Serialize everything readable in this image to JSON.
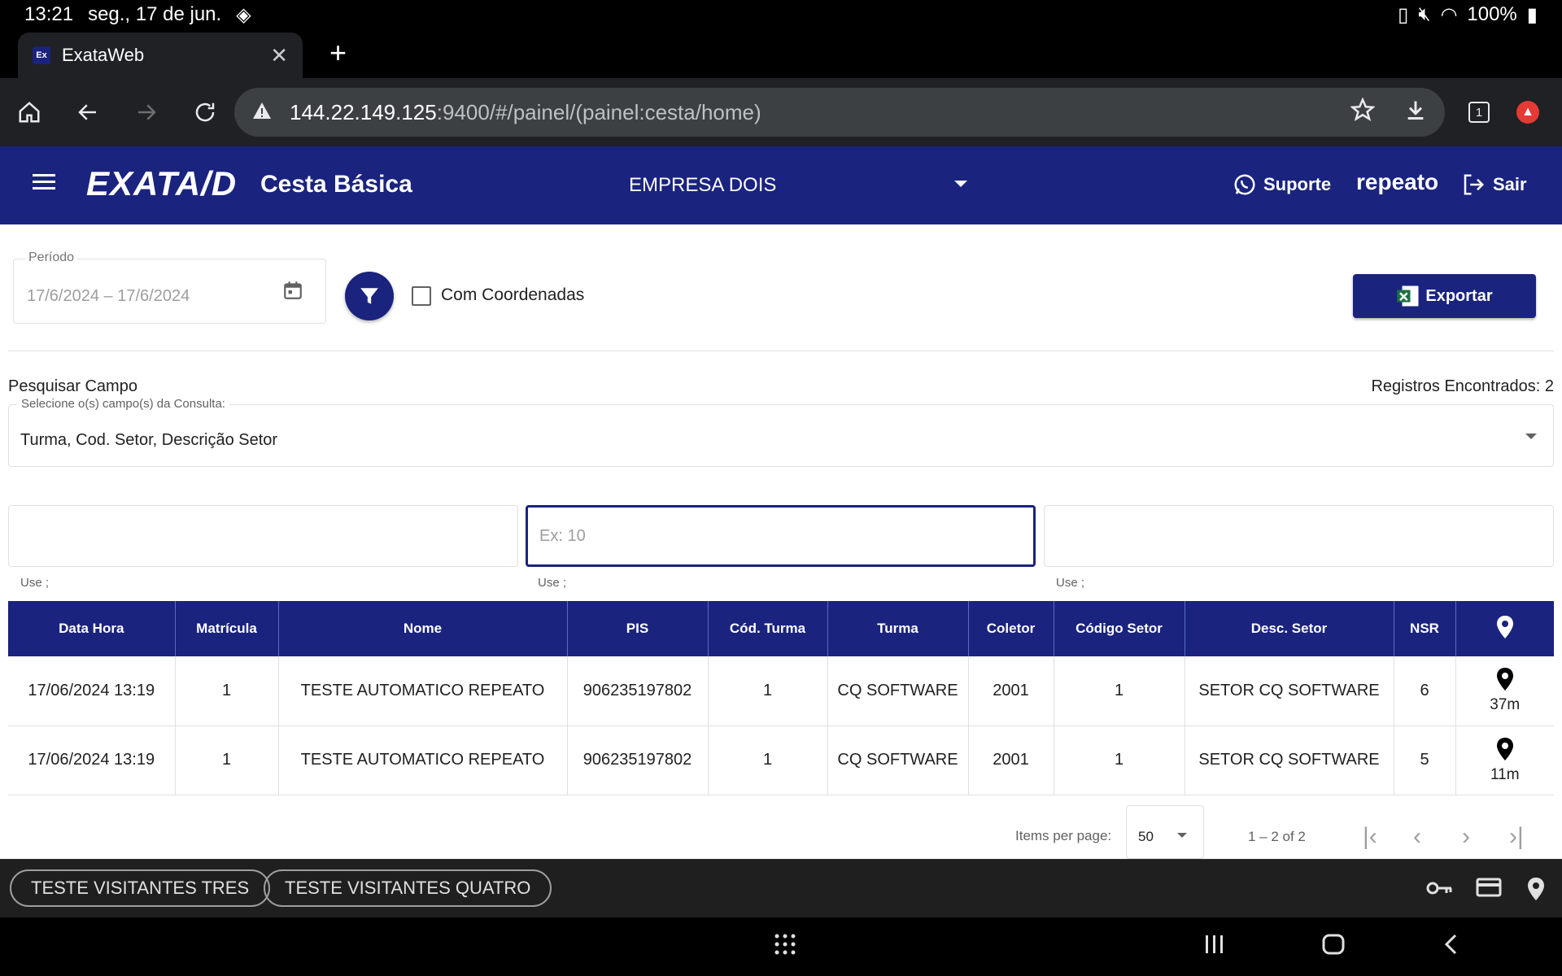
{
  "status": {
    "time": "13:21",
    "date": "seg., 17 de jun.",
    "battery": "100%"
  },
  "browser": {
    "tab_title": "ExataWeb",
    "tab_favicon": "Ex",
    "url_host": "144.22.149.125",
    "url_path": ":9400/#/painel/(painel:cesta/home)",
    "tab_count": "1"
  },
  "app": {
    "logo": "EXATA/D",
    "title": "Cesta Básica",
    "company": "EMPRESA DOIS",
    "support_label": "Suporte",
    "user": "repeato",
    "logout_label": "Sair"
  },
  "filters": {
    "period_label": "Período",
    "period_value": "17/6/2024 – 17/6/2024",
    "coords_label": "Com Coordenadas",
    "export_label": "Exportar"
  },
  "search": {
    "label": "Pesquisar Campo",
    "records": "Registros Encontrados: 2",
    "select_label": "Selecione o(s) campo(s) da Consulta:",
    "select_value": "Turma, Cod. Setor, Descrição Setor",
    "input2_placeholder": "Ex: 10",
    "hint": "Use ;"
  },
  "table": {
    "headers": [
      "Data Hora",
      "Matrícula",
      "Nome",
      "PIS",
      "Cód. Turma",
      "Turma",
      "Coletor",
      "Código Setor",
      "Desc. Setor",
      "NSR"
    ],
    "rows": [
      [
        "17/06/2024 13:19",
        "1",
        "TESTE AUTOMATICO REPEATO",
        "906235197802",
        "1",
        "CQ SOFTWARE",
        "2001",
        "1",
        "SETOR CQ SOFTWARE",
        "6",
        "37m"
      ],
      [
        "17/06/2024 13:19",
        "1",
        "TESTE AUTOMATICO REPEATO",
        "906235197802",
        "1",
        "CQ SOFTWARE",
        "2001",
        "1",
        "SETOR CQ SOFTWARE",
        "5",
        "11m"
      ]
    ]
  },
  "paginator": {
    "items_label": "Items per page:",
    "page_size": "50",
    "range": "1 – 2 of 2"
  },
  "bottom": {
    "chip1": "TESTE VISITANTES TRES",
    "chip2": "TESTE VISITANTES QUATRO"
  },
  "colors": {
    "primary": "#1a237e"
  }
}
